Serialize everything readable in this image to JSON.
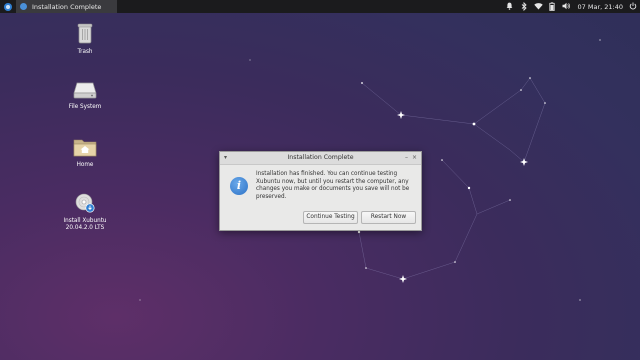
{
  "panel": {
    "task_title": "Installation Complete",
    "clock": "07 Mar, 21:40",
    "tray_icons": [
      "bell-icon",
      "bluetooth-icon",
      "wifi-icon",
      "battery-icon",
      "volume-icon",
      "power-icon"
    ]
  },
  "desktop": {
    "icons": [
      {
        "label": "Trash",
        "icon": "trash-icon"
      },
      {
        "label": "File System",
        "icon": "drive-icon"
      },
      {
        "label": "Home",
        "icon": "home-folder-icon"
      },
      {
        "label": "Install Xubuntu 20.04.2.0 LTS",
        "icon": "installer-disc-icon"
      }
    ]
  },
  "dialog": {
    "title": "Installation Complete",
    "message": "Installation has finished.  You can continue testing Xubuntu now, but until you restart the computer, any changes you make or documents you save will not be preserved.",
    "continue_label": "Continue Testing",
    "restart_label": "Restart Now"
  },
  "colors": {
    "panel_bg": "#1b1b1d",
    "accent": "#2d72c6",
    "desktop_bg": "#3b2c5c"
  }
}
